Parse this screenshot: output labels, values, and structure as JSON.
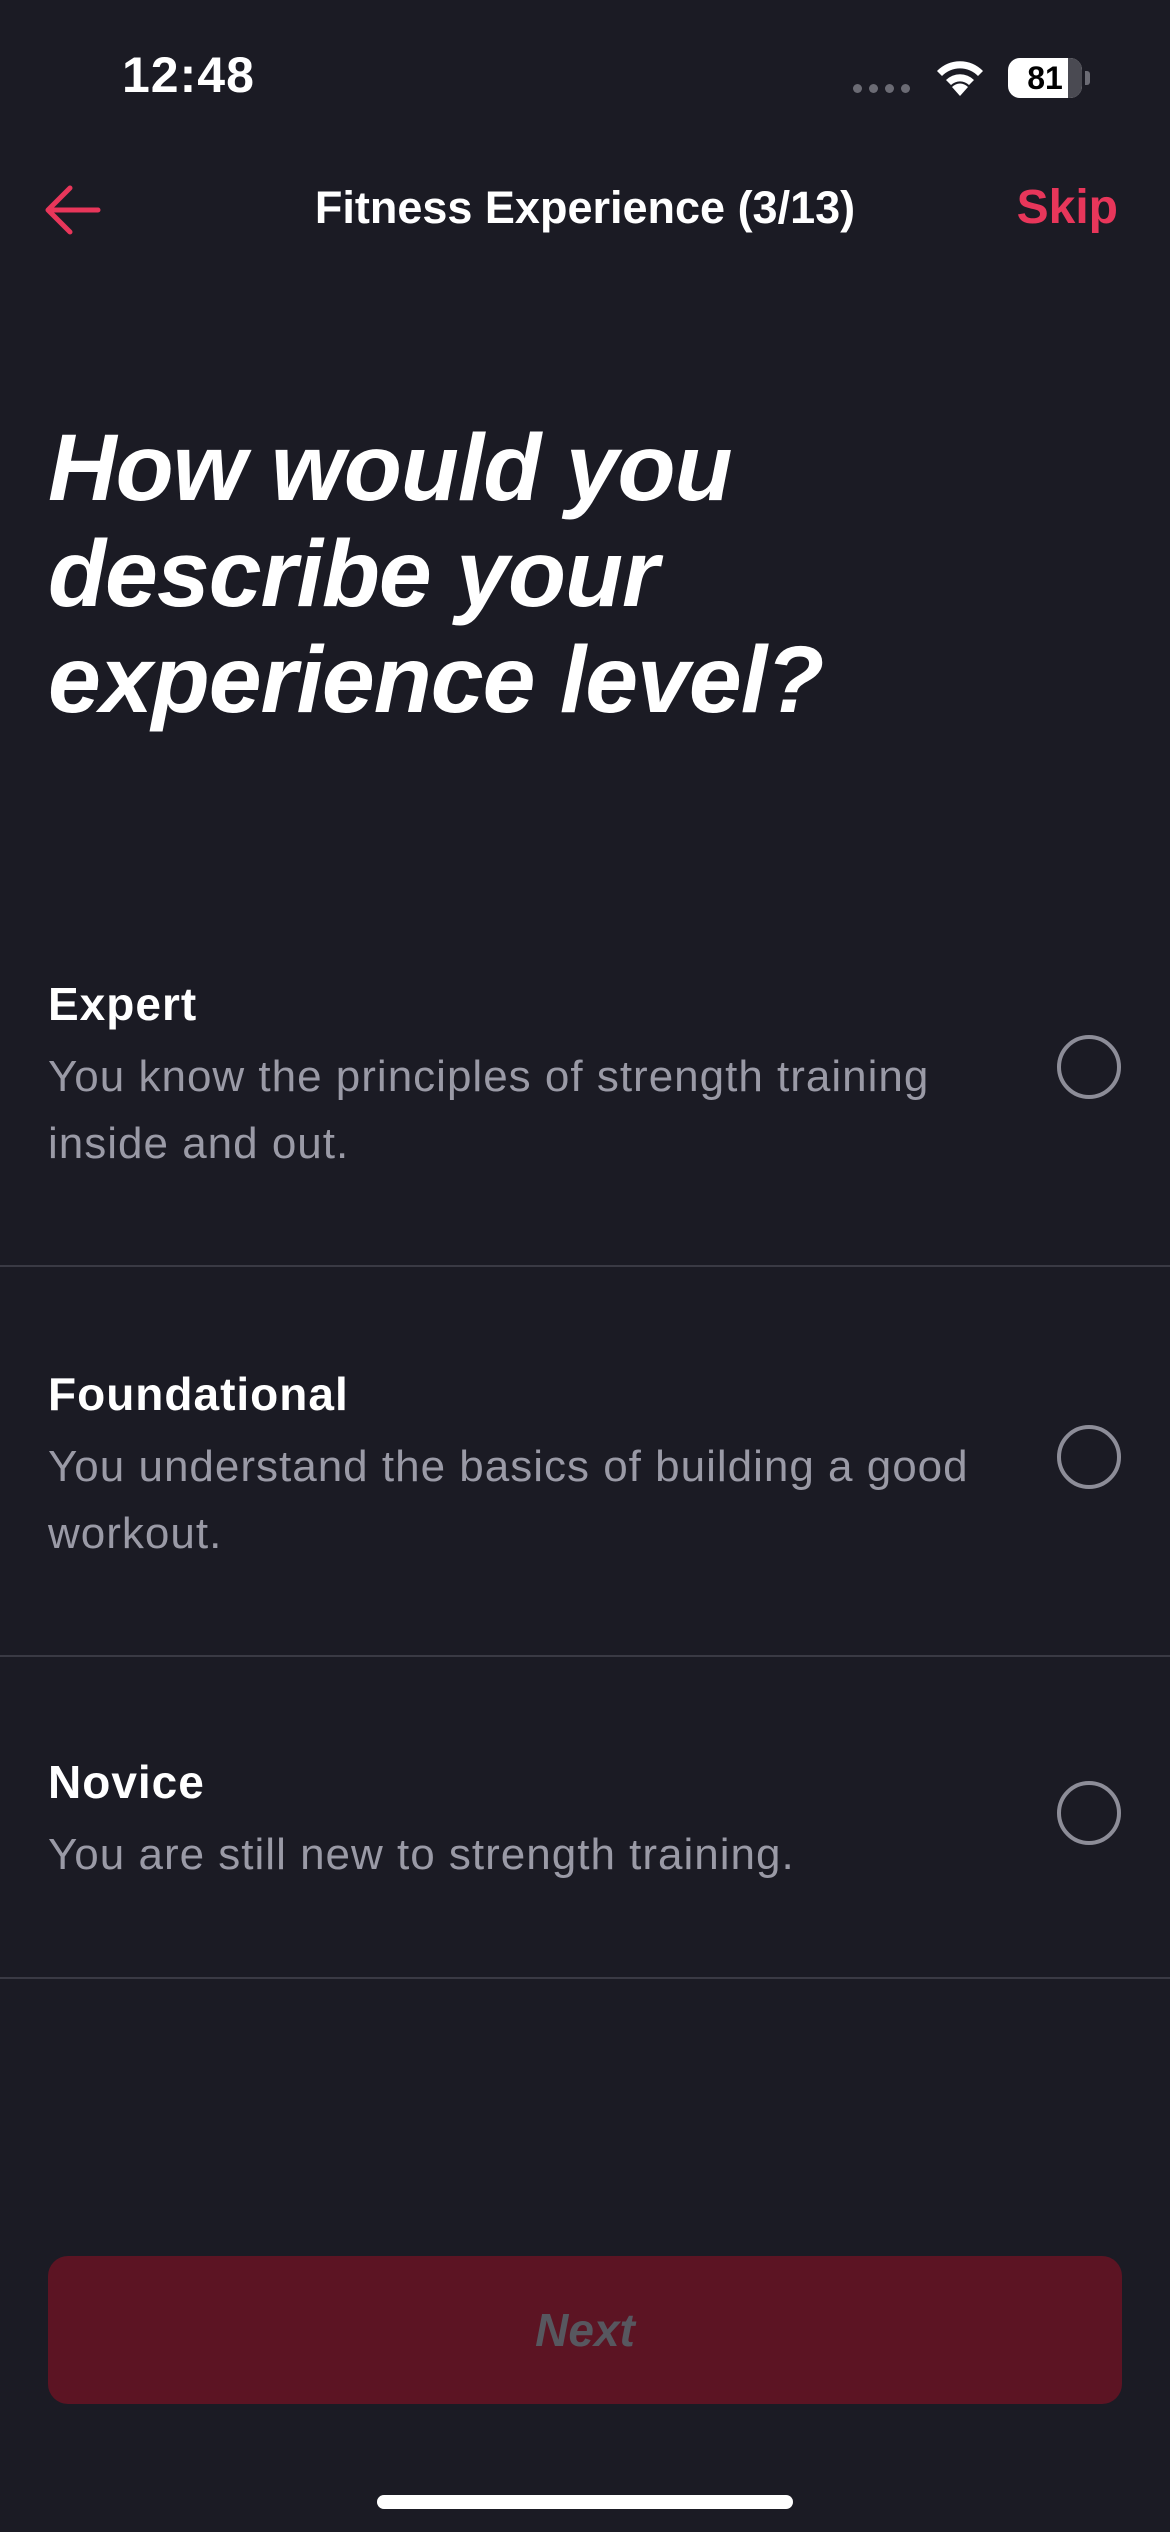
{
  "status_bar": {
    "time": "12:48",
    "battery_level": "81",
    "battery_fraction": 0.81
  },
  "header": {
    "back_icon": "arrow-left-icon",
    "title": "Fitness Experience (3/13)",
    "skip_label": "Skip",
    "accent_color": "#e8365a"
  },
  "question": {
    "title": "How would you describe your experience level?"
  },
  "options": [
    {
      "title": "Expert",
      "description": "You know the principles of strength training inside and out.",
      "selected": false
    },
    {
      "title": "Foundational",
      "description": "You understand the basics of building a good workout.",
      "selected": false
    },
    {
      "title": "Novice",
      "description": "You are still new to strength training.",
      "selected": false
    }
  ],
  "footer": {
    "next_label": "Next",
    "next_enabled": false
  },
  "colors": {
    "background": "#1b1b24",
    "divider": "#3a3a44",
    "secondary_text": "#9a9aa6",
    "disabled_button": "#5c1423"
  }
}
